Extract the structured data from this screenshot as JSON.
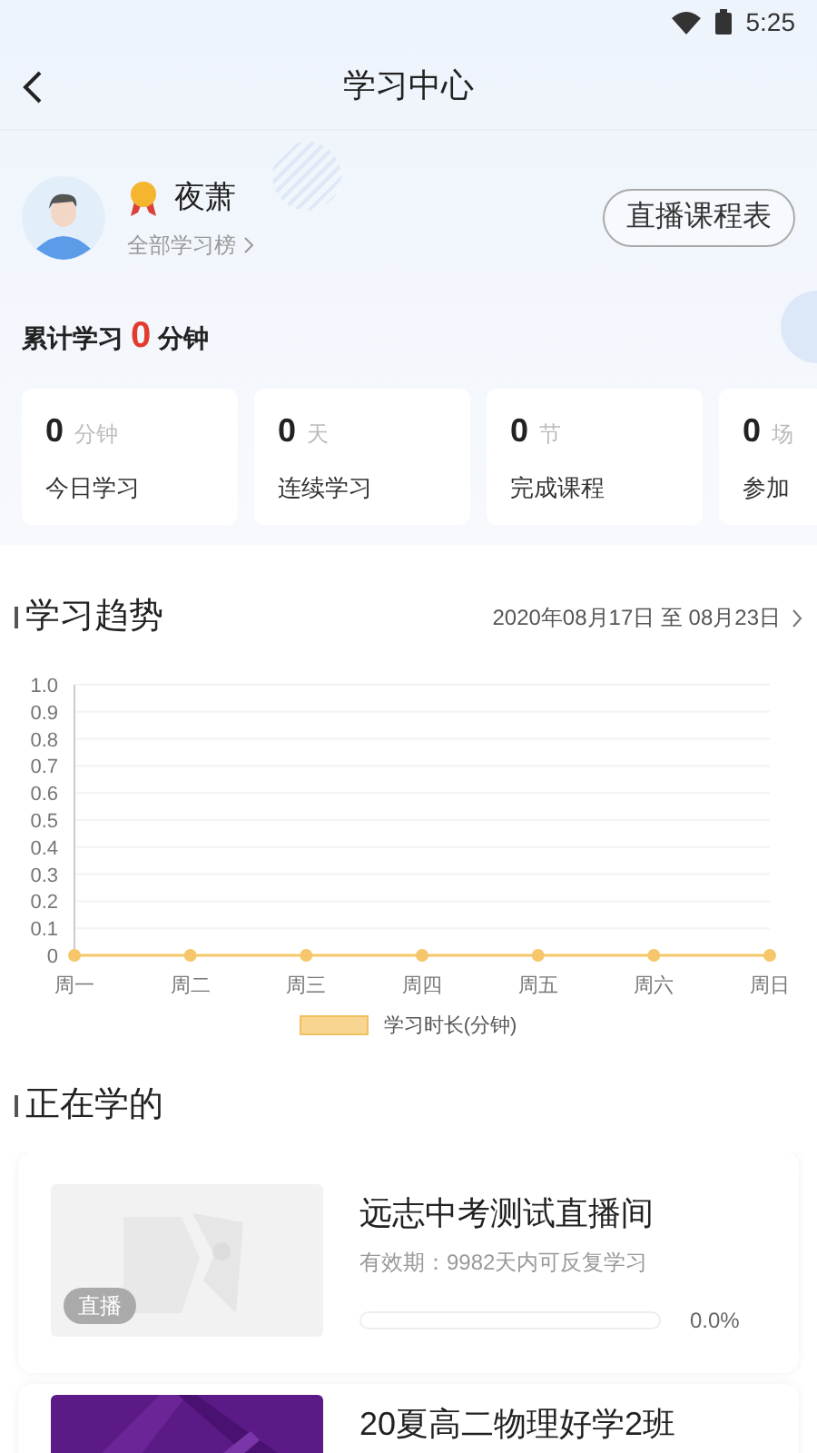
{
  "status_bar": {
    "time": "5:25"
  },
  "header": {
    "title": "学习中心"
  },
  "profile": {
    "name": "夜萧",
    "rank_link": "全部学习榜",
    "schedule_button": "直播课程表"
  },
  "total": {
    "prefix": "累计学习",
    "value": "0",
    "unit": "分钟"
  },
  "stats": [
    {
      "value": "0",
      "unit": "分钟",
      "label": "今日学习"
    },
    {
      "value": "0",
      "unit": "天",
      "label": "连续学习"
    },
    {
      "value": "0",
      "unit": "节",
      "label": "完成课程"
    },
    {
      "value": "0",
      "unit": "场",
      "label": "参加"
    }
  ],
  "trend": {
    "title": "学习趋势",
    "date_range": "2020年08月17日 至 08月23日",
    "chart_data": {
      "type": "line",
      "categories": [
        "周一",
        "周二",
        "周三",
        "周四",
        "周五",
        "周六",
        "周日"
      ],
      "grid": true,
      "series": [
        {
          "name": "学习时长(分钟)",
          "color": "#f5c76a",
          "marker": "circle",
          "values": [
            0,
            0,
            0,
            0,
            0,
            0,
            0
          ]
        }
      ],
      "ylim": [
        0,
        1
      ],
      "yticks": [
        {
          "value": 0,
          "label": "0"
        },
        {
          "value": 0.1,
          "label": "0.1"
        },
        {
          "value": 0.2,
          "label": "0.2"
        },
        {
          "value": 0.3,
          "label": "0.3"
        },
        {
          "value": 0.4,
          "label": "0.4"
        },
        {
          "value": 0.5,
          "label": "0.5"
        },
        {
          "value": 0.6,
          "label": "0.6"
        },
        {
          "value": 0.7,
          "label": "0.7"
        },
        {
          "value": 0.8,
          "label": "0.8"
        },
        {
          "value": 0.9,
          "label": "0.9"
        },
        {
          "value": 1,
          "label": "1.0"
        }
      ]
    }
  },
  "learning": {
    "title": "正在学的",
    "courses": [
      {
        "kind": "placeholder",
        "badge": "直播",
        "title": "远志中考测试直播间",
        "validity": "有效期：9982天内可反复学习",
        "level": 0,
        "percent": "0.0%"
      },
      {
        "kind": "picture",
        "title": "20夏高二物理好学2班"
      }
    ]
  }
}
